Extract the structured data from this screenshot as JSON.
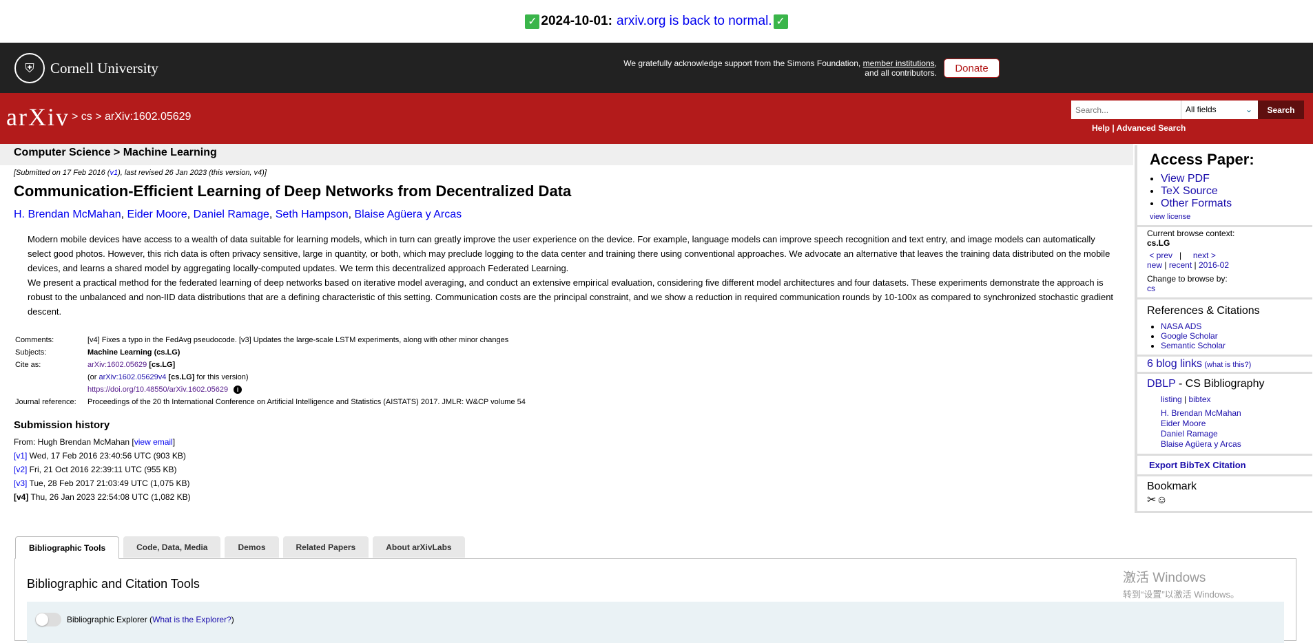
{
  "announcement": {
    "date": "2024-10-01:",
    "link_text": "arxiv.org is back to normal."
  },
  "cornell": {
    "name": "Cornell University",
    "ack_text": "We gratefully acknowledge support from the Simons Foundation,",
    "ack_link": "member institutions",
    "ack_tail": ", and all contributors.",
    "donate_label": "Donate"
  },
  "header": {
    "logo_text": "arXiv",
    "breadcrumb": "> cs > arXiv:1602.05629",
    "search_placeholder": "Search...",
    "search_field": "All fields",
    "search_label": "Search",
    "help": "Help",
    "advanced": "Advanced Search"
  },
  "subject_bar": "Computer Science > Machine Learning",
  "paper": {
    "dateline_pre": "[Submitted on 17 Feb 2016 (",
    "dateline_v1": "v1",
    "dateline_post": "), last revised 26 Jan 2023 (this version, v4)]",
    "title": "Communication-Efficient Learning of Deep Networks from Decentralized Data",
    "authors": [
      "H. Brendan McMahan",
      "Eider Moore",
      "Daniel Ramage",
      "Seth Hampson",
      "Blaise Agüera y Arcas"
    ],
    "abstract_p1": "Modern mobile devices have access to a wealth of data suitable for learning models, which in turn can greatly improve the user experience on the device. For example, language models can improve speech recognition and text entry, and image models can automatically select good photos. However, this rich data is often privacy sensitive, large in quantity, or both, which may preclude logging to the data center and training there using conventional approaches. We advocate an alternative that leaves the training data distributed on the mobile devices, and learns a shared model by aggregating locally-computed updates. We term this decentralized approach Federated Learning.",
    "abstract_p2": "We present a practical method for the federated learning of deep networks based on iterative model averaging, and conduct an extensive empirical evaluation, considering five different model architectures and four datasets. These experiments demonstrate the approach is robust to the unbalanced and non-IID data distributions that are a defining characteristic of this setting. Communication costs are the principal constraint, and we show a reduction in required communication rounds by 10-100x as compared to synchronized stochastic gradient descent.",
    "meta": {
      "comments_label": "Comments:",
      "comments": "[v4] Fixes a typo in the FedAvg pseudocode. [v3] Updates the large-scale LSTM experiments, along with other minor changes",
      "subjects_label": "Subjects:",
      "subjects": "Machine Learning (cs.LG)",
      "cite_label": "Cite as:",
      "cite_id": "arXiv:1602.05629",
      "cite_cat": "[cs.LG]",
      "cite_or_pre": "(or ",
      "cite_version": "arXiv:1602.05629v4",
      "cite_version_cat": "[cs.LG]",
      "cite_or_post": " for this version)",
      "doi": "https://doi.org/10.48550/arXiv.1602.05629",
      "journal_label": "Journal reference:",
      "journal": "Proceedings of the 20 th International Conference on Artificial Intelligence and Statistics (AISTATS) 2017. JMLR: W&CP volume 54"
    },
    "history_title": "Submission history",
    "history_from": "From: Hugh Brendan McMahan [",
    "history_email": "view email",
    "history_from_end": "]",
    "versions": [
      {
        "v": "[v1]",
        "text": " Wed, 17 Feb 2016 23:40:56 UTC (903 KB)"
      },
      {
        "v": "[v2]",
        "text": " Fri, 21 Oct 2016 22:39:11 UTC (955 KB)"
      },
      {
        "v": "[v3]",
        "text": " Tue, 28 Feb 2017 21:03:49 UTC (1,075 KB)"
      },
      {
        "v": "[v4]",
        "text": " Thu, 26 Jan 2023 22:54:08 UTC (1,082 KB)"
      }
    ]
  },
  "tabs": [
    "Bibliographic Tools",
    "Code, Data, Media",
    "Demos",
    "Related Papers",
    "About arXivLabs"
  ],
  "tab_panel": {
    "title": "Bibliographic and Citation Tools",
    "explorer_label": "Bibliographic Explorer (",
    "explorer_link": "What is the Explorer?",
    "explorer_end": ")"
  },
  "watermark": {
    "line1": "激活 Windows",
    "line2": "转到“设置”以激活 Windows。"
  },
  "sidebar": {
    "access_title": "Access Paper:",
    "access_links": [
      "View PDF",
      "TeX Source",
      "Other Formats"
    ],
    "view_license": "view license",
    "context_title": "Current browse context:",
    "context_value": "cs.LG",
    "prev": "< prev",
    "next": "next >",
    "new": "new",
    "recent": "recent",
    "month": "2016-02",
    "change_title": "Change to browse by:",
    "change_value": "cs",
    "refs_title": "References & Citations",
    "refs_links": [
      "NASA ADS",
      "Google Scholar",
      "Semantic Scholar"
    ],
    "blog_links": "6 blog links",
    "blog_what": "(what is this?)",
    "dblp": "DBLP",
    "dblp_tail": " - CS Bibliography",
    "dblp_listing": "listing",
    "dblp_bibtex": "bibtex",
    "dblp_authors": [
      "H. Brendan McMahan",
      "Eider Moore",
      "Daniel Ramage",
      "Blaise Agüera y Arcas"
    ],
    "export": "Export BibTeX Citation",
    "bookmark": "Bookmark"
  }
}
